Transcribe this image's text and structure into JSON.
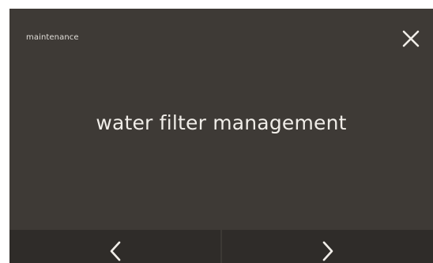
{
  "header": {
    "title": "maintenance",
    "close_icon": "close-icon"
  },
  "main": {
    "title": "water filter management"
  },
  "navigation": {
    "previous_icon": "chevron-left-icon",
    "next_icon": "chevron-right-icon"
  },
  "colors": {
    "panel_background": "#3e3a36",
    "nav_background": "#2f2c29",
    "text": "#f0ede8"
  }
}
